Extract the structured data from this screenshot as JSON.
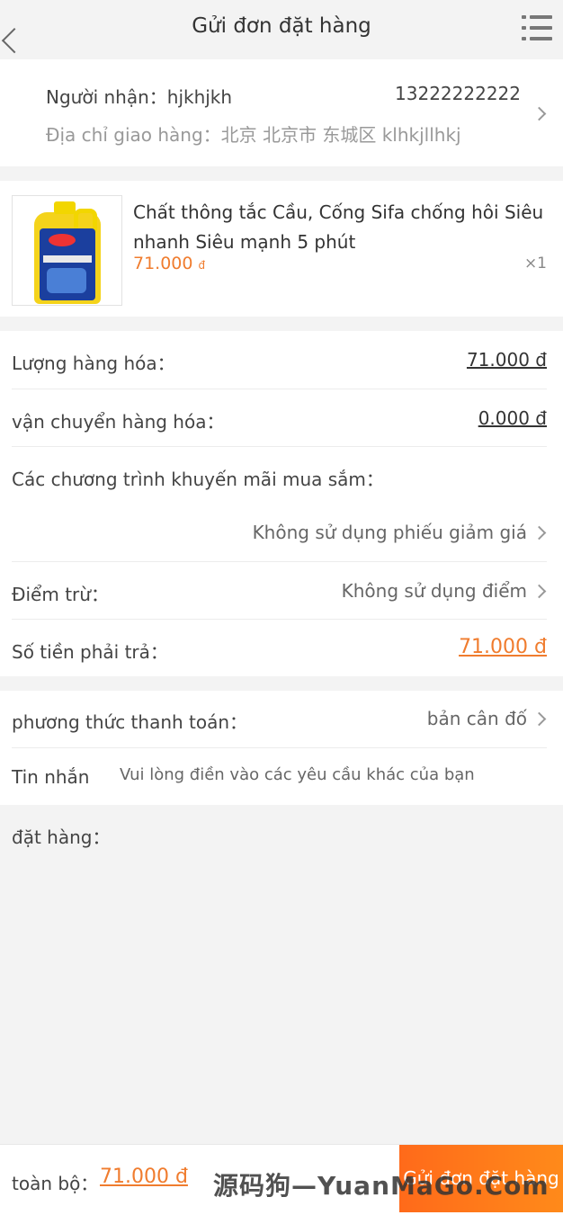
{
  "header": {
    "title": "Gửi đơn đặt hàng"
  },
  "address": {
    "recipient": "Người nhận：hjkhjkh",
    "phone": "13222222222",
    "line": "Địa chỉ giao hàng：北京 北京市 东城区 klhkjllhkj"
  },
  "product": {
    "name": "Chất thông tắc Cầu, Cống Sifa chống hôi Siêu nhanh Siêu mạnh 5 phút",
    "price": "71.000",
    "currency": "đ",
    "quantity": "×1",
    "image": "product-bottle"
  },
  "summary": {
    "goods_label": "Lượng hàng hóa：",
    "goods_value": "71.000 đ",
    "shipping_label": "vận chuyển hàng hóa：",
    "shipping_value": "0.000 đ",
    "promo_label": "Các chương trình khuyến mãi mua sắm：",
    "coupon_value": "Không sử dụng phiếu giảm giá",
    "points_label": "Điểm trừ：",
    "points_value": "Không sử dụng điểm",
    "payable_label": "Số tiền phải trả：",
    "payable_value": "71.000 đ"
  },
  "payment": {
    "method_label": "phương thức thanh toán：",
    "method_value": "bản cân đố",
    "message_label": "Tin nhắn",
    "message_placeholder": "Vui lòng điền vào các yêu cầu khác của bạn"
  },
  "note": {
    "label": "đặt hàng："
  },
  "footer": {
    "total_label": "toàn bộ：",
    "total_value": "71.000 đ",
    "submit_label": "Gửi đơn đặt hàng"
  },
  "watermark": "源码狗—YuanMaGo.Com",
  "colors": {
    "accent": "#f07c2e",
    "button": "#ff6a1a"
  }
}
